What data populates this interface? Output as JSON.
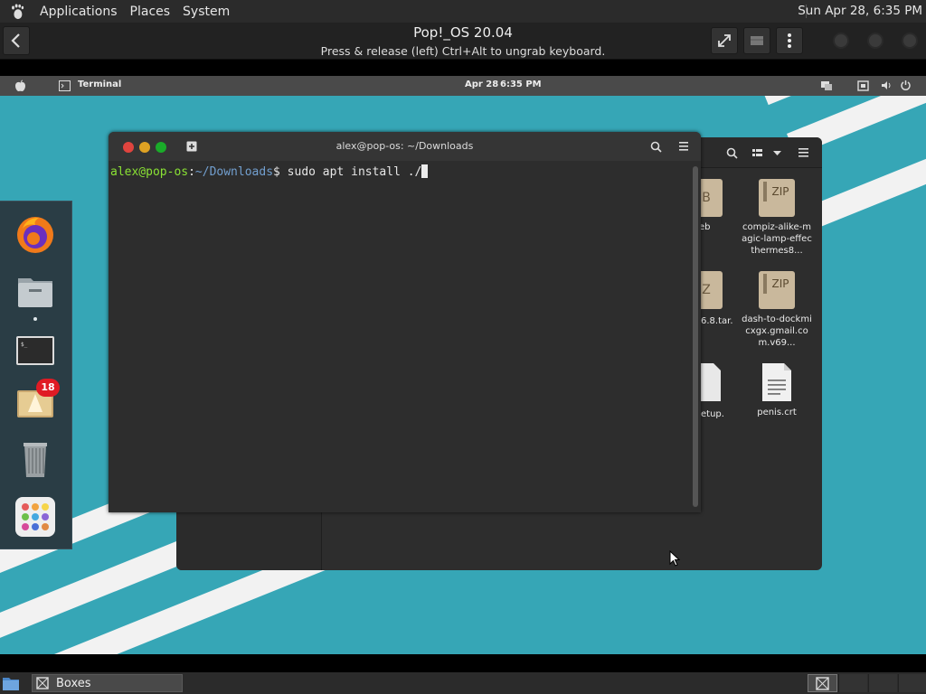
{
  "host": {
    "menu": [
      "Applications",
      "Places",
      "System"
    ],
    "clock": "Sun Apr 28,  6:35 PM"
  },
  "boxes": {
    "title": "Pop!_OS 20.04",
    "subtitle": "Press & release (left) Ctrl+Alt to ungrab keyboard."
  },
  "vm_panel": {
    "app": "Terminal",
    "date": "Apr 28",
    "time": "6:35 PM"
  },
  "dock": {
    "badge": "18"
  },
  "files": {
    "items": [
      {
        "label": "eb",
        "icon": "deb-icon"
      },
      {
        "label": "compiz-alike-magic-lamp-effecthermes8...",
        "icon": "zip-icon",
        "badge": "ZIP"
      },
      {
        "label": "6.8.tar.",
        "icon": "tar-icon"
      },
      {
        "label": "dash-to-dockmicxgx.gmail.com.v69...",
        "icon": "zip-icon",
        "badge": "ZIP"
      },
      {
        "label": "etup.",
        "icon": "script-icon"
      },
      {
        "label": "penis.crt",
        "icon": "text-file-icon"
      }
    ]
  },
  "terminal": {
    "title": "alex@pop-os: ~/Downloads",
    "prompt_user": "alex@pop-os",
    "prompt_sep": ":",
    "prompt_path": "~/Downloads",
    "prompt_end": "$ ",
    "command": "sudo apt install ./"
  },
  "taskbar": {
    "task": "Boxes"
  },
  "colors": {
    "desktop": "#36a6b6",
    "prompt_user": "#8ae234",
    "prompt_path": "#729fcf"
  }
}
